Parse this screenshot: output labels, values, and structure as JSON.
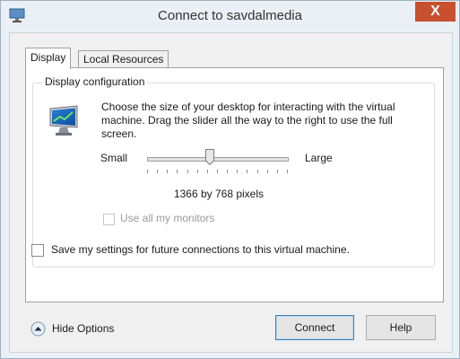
{
  "window": {
    "title": "Connect to savdalmedia",
    "close_glyph": "X"
  },
  "tabs": [
    {
      "label": "Display",
      "active": true
    },
    {
      "label": "Local Resources",
      "active": false
    }
  ],
  "display_config": {
    "group_label": "Display configuration",
    "description": "Choose the size of your desktop for interacting with the virtual machine. Drag the slider all the way to the right to use the full screen.",
    "slider": {
      "min_label": "Small",
      "max_label": "Large",
      "position_fraction": 0.45,
      "resolution_text": "1366 by 768 pixels"
    },
    "use_all_monitors": {
      "label": "Use all my monitors",
      "checked": false,
      "enabled": false
    }
  },
  "save_settings": {
    "label": "Save my settings for future connections to this virtual machine.",
    "checked": false
  },
  "footer": {
    "hide_options_label": "Hide Options",
    "connect_label": "Connect",
    "help_label": "Help"
  },
  "icons": {
    "app": "computer-icon",
    "monitor": "monitor-icon",
    "hide": "chevron-up-circle-icon"
  },
  "colors": {
    "close_button": "#c7502f",
    "default_button_border": "#3c7fb1"
  }
}
